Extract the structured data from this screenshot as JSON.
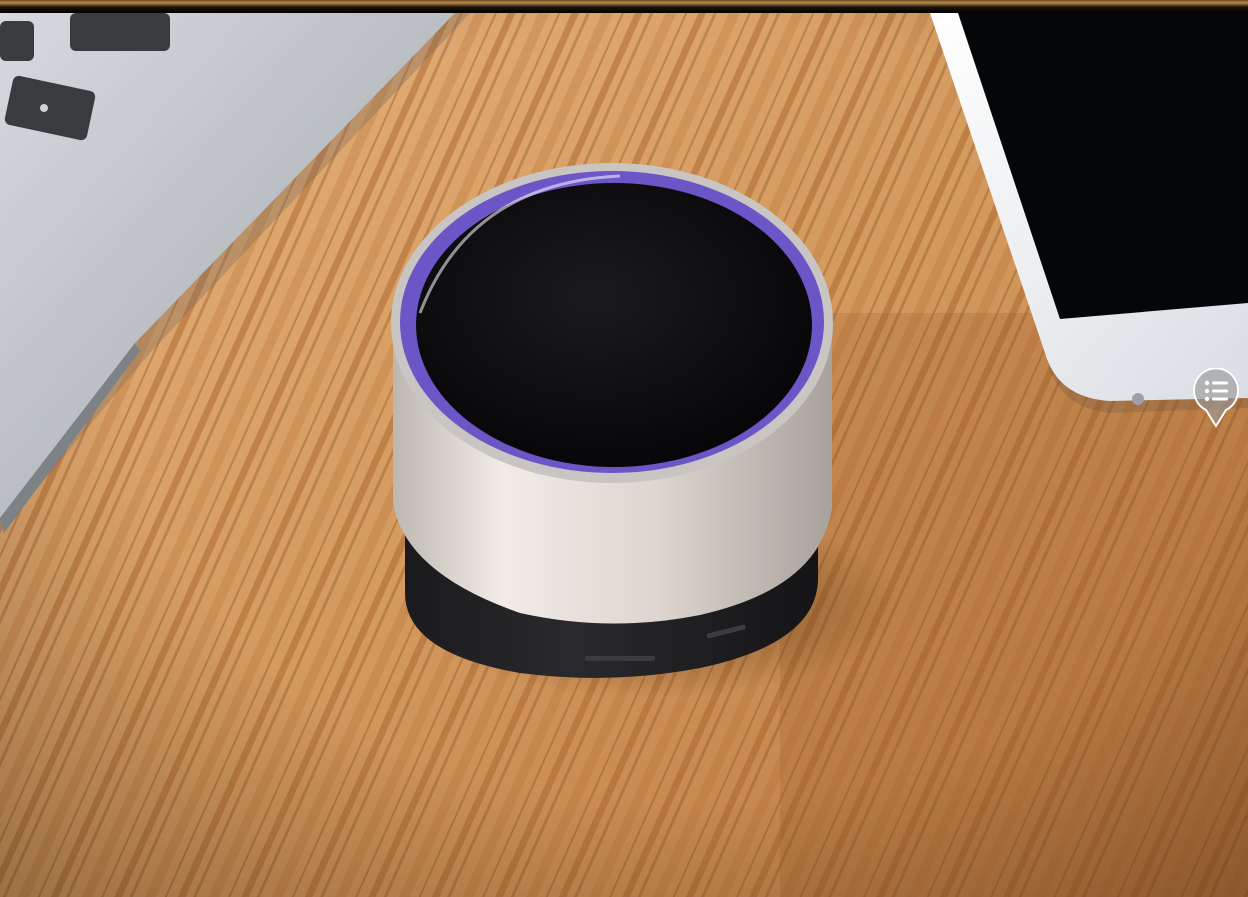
{
  "photo": {
    "subject": "",
    "colors": {
      "wood_light": "#d79c62",
      "wood_dark": "#a7642c",
      "speaker_body": "#d8d2cc",
      "speaker_grill": "#0d0d0f",
      "speaker_ring": "#6b55c7",
      "laptop": "#b8bcc2",
      "phone": "#eef1f4"
    }
  },
  "overlay": {
    "marker_icon": "list-icon"
  }
}
